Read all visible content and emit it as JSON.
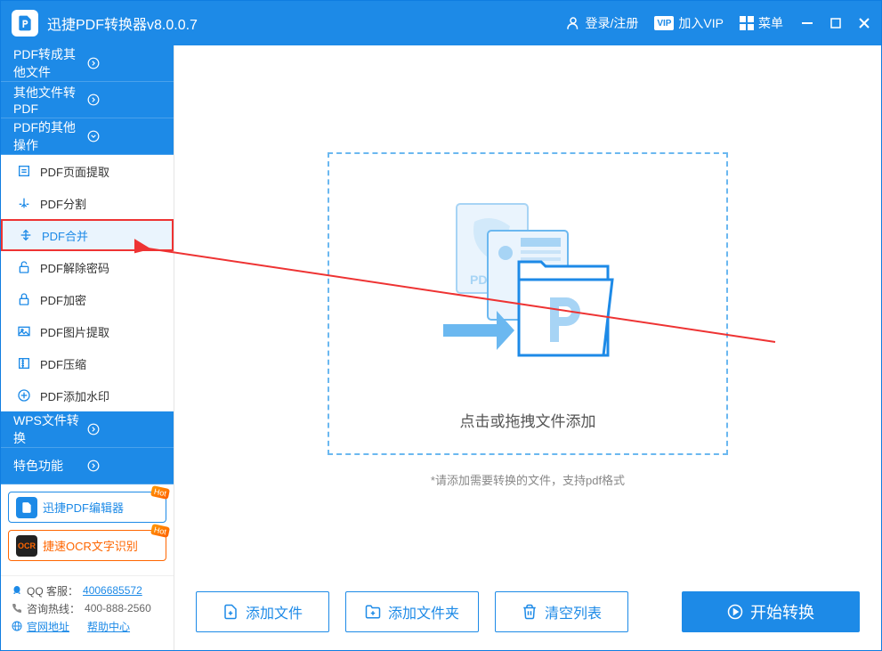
{
  "app": {
    "title": "迅捷PDF转换器v8.0.0.7"
  },
  "header": {
    "login": "登录/注册",
    "vip": "加入VIP",
    "menu": "菜单"
  },
  "sidebar": {
    "categories": [
      {
        "label": "PDF转成其他文件",
        "expanded": false
      },
      {
        "label": "其他文件转PDF",
        "expanded": false
      },
      {
        "label": "PDF的其他操作",
        "expanded": true
      },
      {
        "label": "WPS文件转换",
        "expanded": false
      },
      {
        "label": "特色功能",
        "expanded": false
      }
    ],
    "pdfOps": [
      {
        "label": "PDF页面提取",
        "icon": "extract"
      },
      {
        "label": "PDF分割",
        "icon": "split"
      },
      {
        "label": "PDF合并",
        "icon": "merge",
        "selected": true
      },
      {
        "label": "PDF解除密码",
        "icon": "unlock"
      },
      {
        "label": "PDF加密",
        "icon": "lock"
      },
      {
        "label": "PDF图片提取",
        "icon": "image"
      },
      {
        "label": "PDF压缩",
        "icon": "compress"
      },
      {
        "label": "PDF添加水印",
        "icon": "watermark"
      }
    ],
    "promos": [
      {
        "label": "迅捷PDF编辑器",
        "hot": true
      },
      {
        "label": "捷速OCR文字识别",
        "hot": true
      }
    ],
    "contact": {
      "qq_label": "QQ 客服：",
      "qq_value": "4006685572",
      "hotline_label": "咨询热线：",
      "hotline_value": "400-888-2560",
      "official": "官网地址",
      "help": "帮助中心"
    }
  },
  "main": {
    "drop_text": "点击或拖拽文件添加",
    "hint": "*请添加需要转换的文件，支持pdf格式",
    "buttons": {
      "add_file": "添加文件",
      "add_folder": "添加文件夹",
      "clear": "清空列表",
      "start": "开始转换"
    }
  }
}
